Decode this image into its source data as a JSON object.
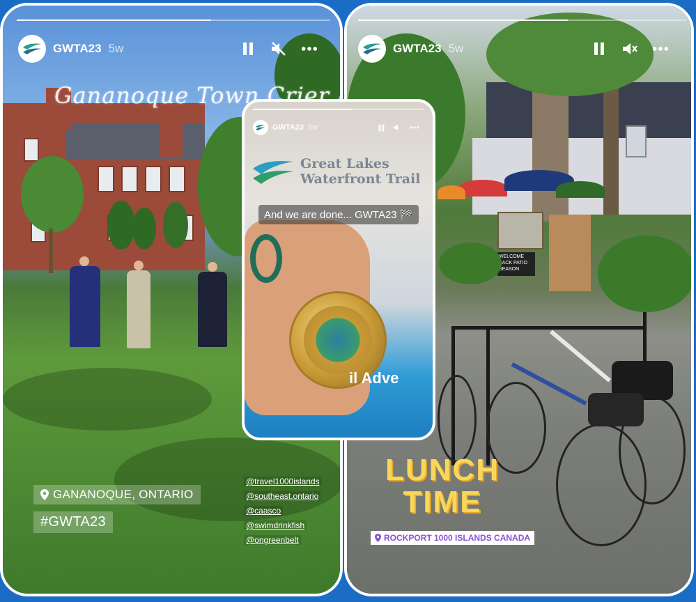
{
  "stories": {
    "left": {
      "username": "GWTA23",
      "age": "5w",
      "overlay_title": "Gananoque Town Crier",
      "location": "GANANOQUE, ONTARIO",
      "hashtag": "#GWTA23",
      "mentions": [
        "@travel1000islands",
        "@southeast.ontario",
        "@caasco",
        "@swimdrinkfish",
        "@ongreenbelt"
      ],
      "progress": 0.62
    },
    "middle": {
      "username": "GWTA23",
      "age": "5w",
      "banner_line1": "Great Lakes",
      "banner_line2": "Waterfront Trail",
      "caption": "And we are done... GWTA23 🏁",
      "bottom_text": "il Adve",
      "progress": 0.58
    },
    "right": {
      "username": "GWTA23",
      "age": "5w",
      "sticker_line1": "LUNCH",
      "sticker_line2": "TIME",
      "location": "ROCKPORT 1000 ISLANDS CANADA",
      "board_text": "WELCOME BACK PATIO SEASON",
      "progress": 0.64
    }
  },
  "colors": {
    "frame_background": "#1b6cc4",
    "logo_teal": "#2a9d8f",
    "lunch_yellow": "#f8d75a",
    "location_purple": "#8a4fd6"
  },
  "icons": [
    "pause-icon",
    "mute-icon",
    "more-icon",
    "location-pin-icon"
  ]
}
